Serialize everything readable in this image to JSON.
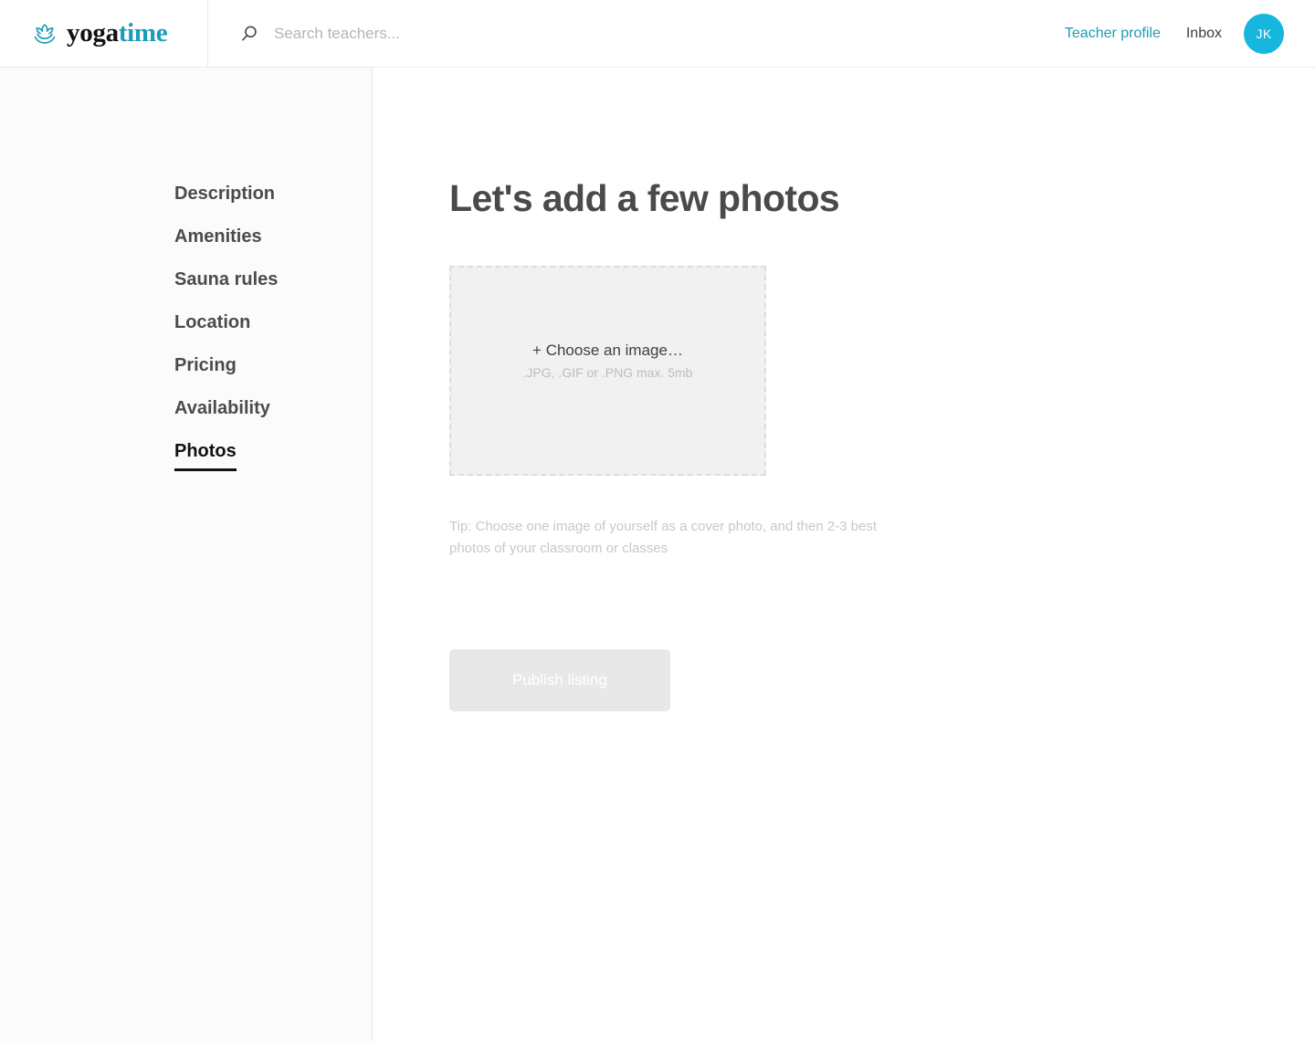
{
  "header": {
    "brand": {
      "icon": "lotus-icon",
      "word_dark": "yoga",
      "word_teal": "time"
    },
    "search": {
      "icon": "search-icon",
      "placeholder": "Search teachers...",
      "value": ""
    },
    "nav": {
      "teacher_profile": "Teacher profile",
      "inbox": "Inbox"
    },
    "avatar": {
      "initials": "JK"
    }
  },
  "sidebar": {
    "items": [
      {
        "label": "Description",
        "active": false
      },
      {
        "label": "Amenities",
        "active": false
      },
      {
        "label": "Sauna rules",
        "active": false
      },
      {
        "label": "Location",
        "active": false
      },
      {
        "label": "Pricing",
        "active": false
      },
      {
        "label": "Availability",
        "active": false
      },
      {
        "label": "Photos",
        "active": true
      }
    ]
  },
  "main": {
    "title": "Let's add a few photos",
    "dropzone": {
      "primary": "+ Choose an image…",
      "secondary": ".JPG, .GIF or .PNG max. 5mb"
    },
    "tip": "Tip: Choose one image of yourself as a cover photo, and then 2-3 best photos of your classroom or classes",
    "publish_label": "Publish listing"
  },
  "colors": {
    "brand_teal": "#1b9cb8",
    "avatar_cyan": "#17b6dc",
    "sidebar_bg": "#fbfbfb",
    "dropzone_bg": "#f1f1f1",
    "dropzone_border": "#dddddd",
    "button_disabled_bg": "#e8e8e8"
  }
}
